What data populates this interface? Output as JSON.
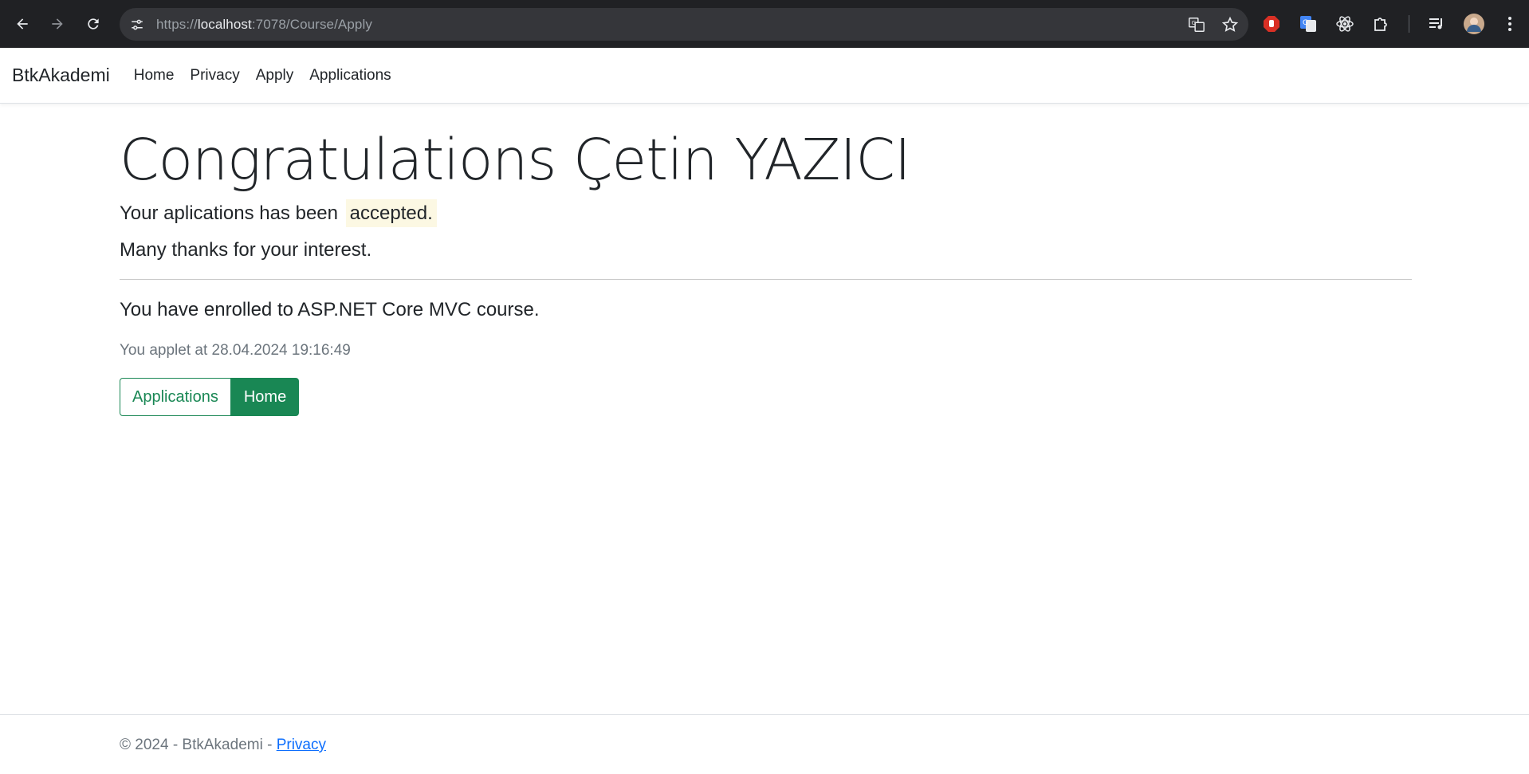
{
  "browser": {
    "url_prefix": "https://",
    "url_host": "localhost",
    "url_rest": ":7078/Course/Apply"
  },
  "navbar": {
    "brand": "BtkAkademi",
    "links": [
      "Home",
      "Privacy",
      "Apply",
      "Applications"
    ]
  },
  "main": {
    "title": "Congratulations Çetin YAZICI",
    "status_text": "Your aplications has been",
    "status_value": "accepted.",
    "thanks": "Many thanks for your interest.",
    "enrolled": "You have enrolled to ASP.NET Core MVC course.",
    "applied_at": "You applet at 28.04.2024 19:16:49",
    "buttons": {
      "applications": "Applications",
      "home": "Home"
    }
  },
  "footer": {
    "text": "© 2024 - BtkAkademi - ",
    "privacy": "Privacy"
  },
  "colors": {
    "accent_green": "#198754",
    "highlight": "#fcf8e3",
    "link_blue": "#0d6efd"
  }
}
